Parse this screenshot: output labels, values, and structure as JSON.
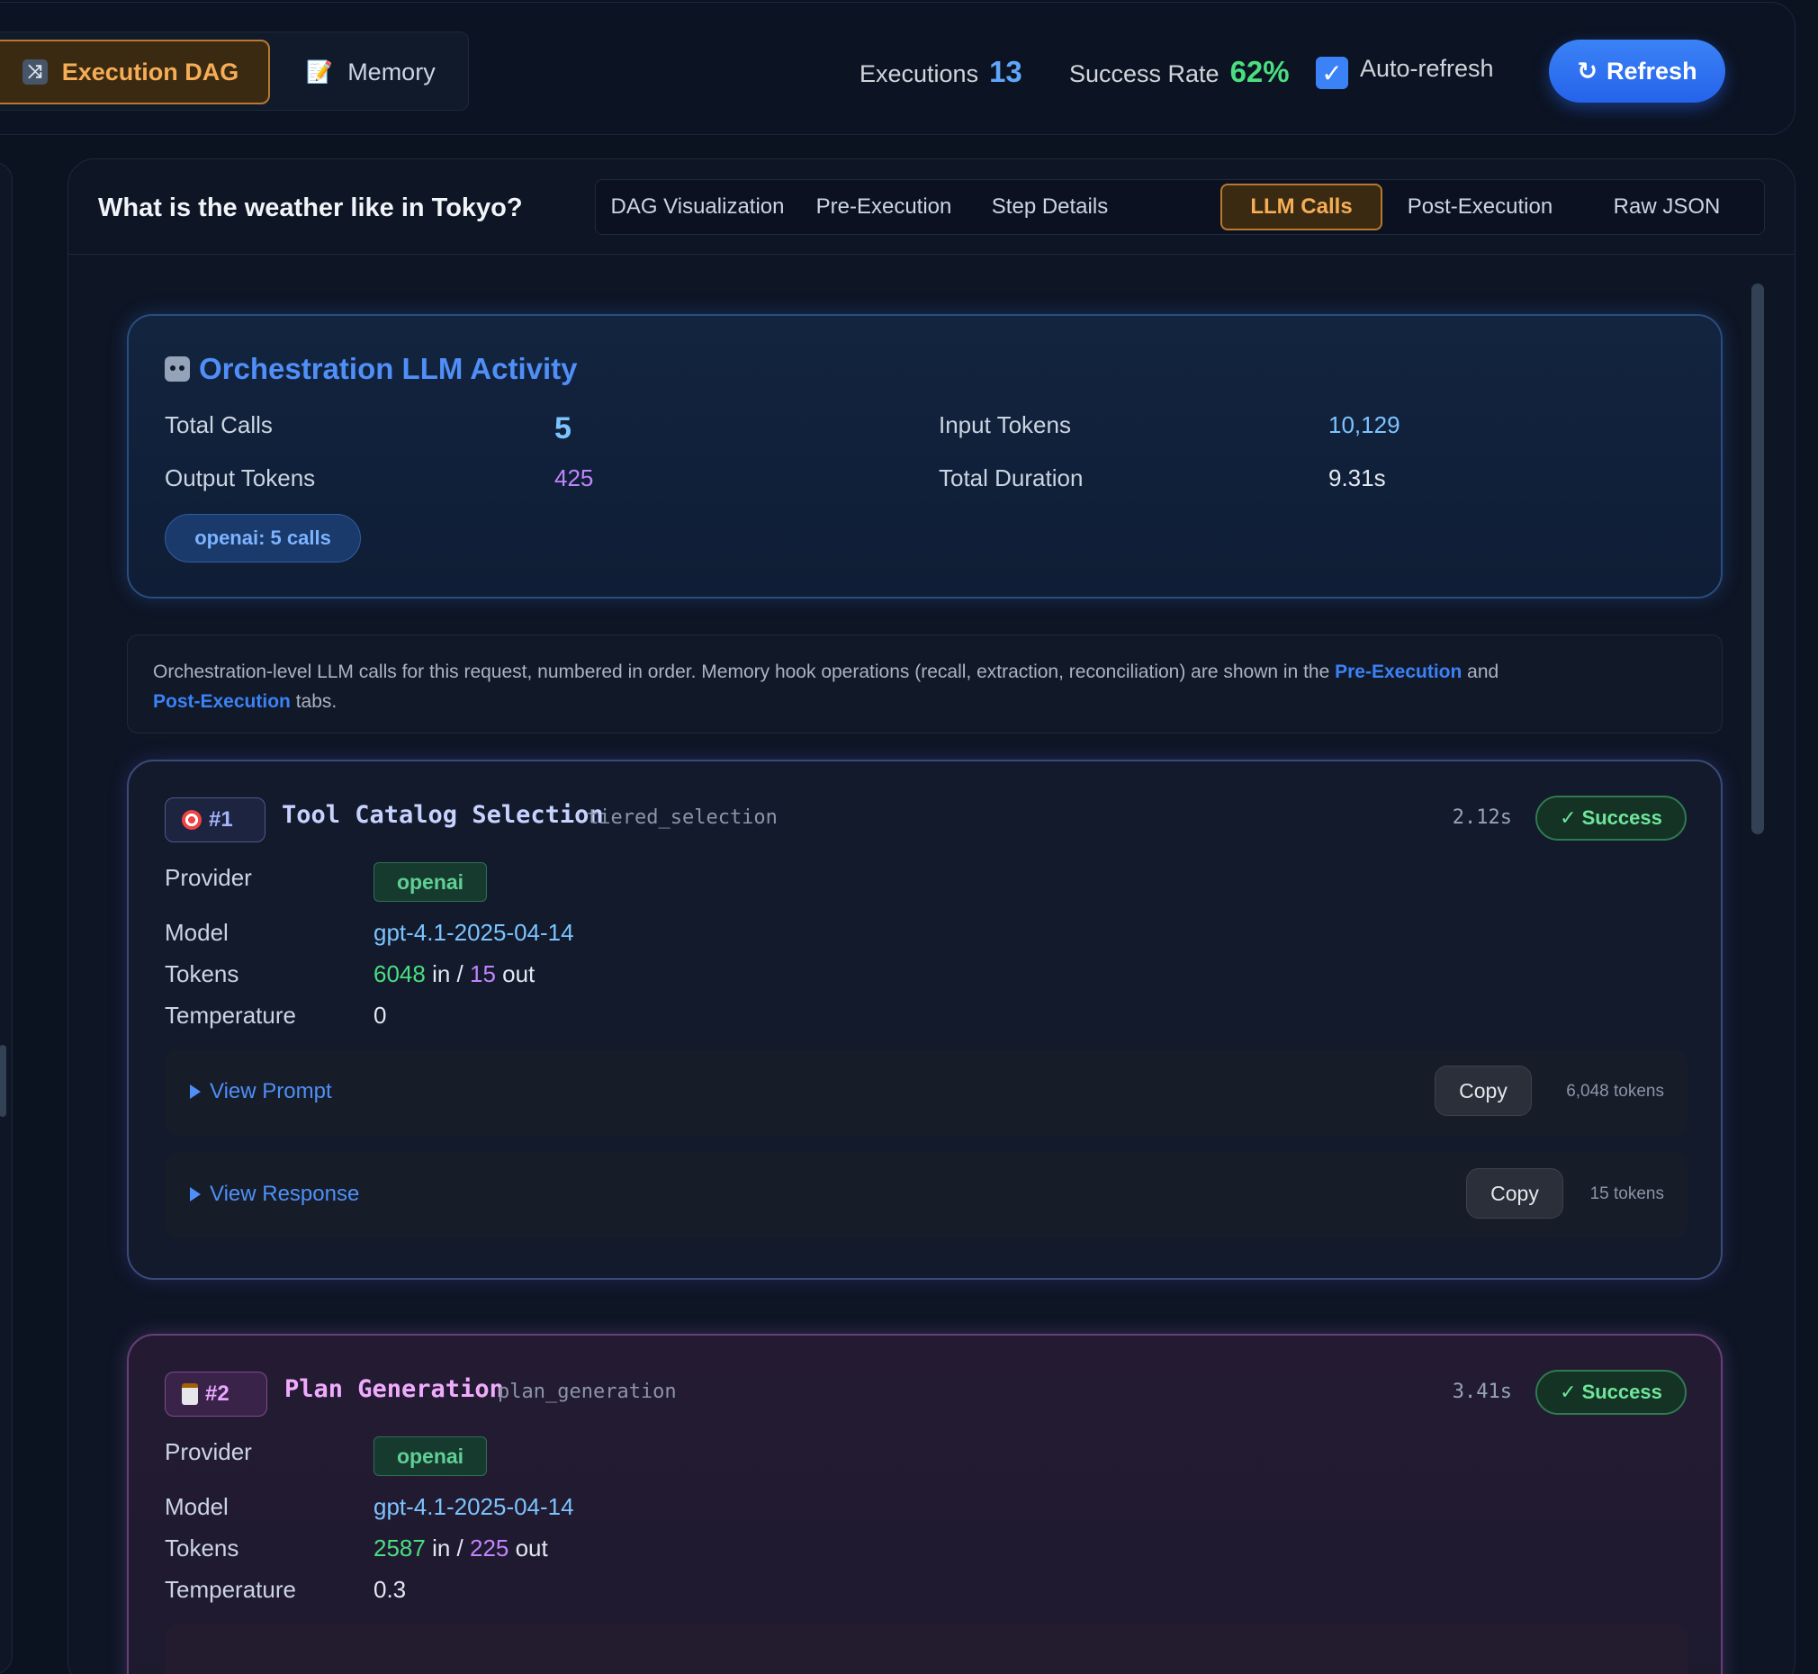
{
  "top_bar": {
    "view_tabs": [
      {
        "label": "Execution DAG",
        "icon": "shuffle-icon",
        "active": true
      },
      {
        "label": "Memory",
        "icon": "memo-icon",
        "active": false
      }
    ],
    "executions_label": "Executions",
    "executions_value": "13",
    "success_rate_label": "Success Rate",
    "success_rate_value": "62%",
    "auto_refresh_label": "Auto-refresh",
    "auto_refresh_checked": true,
    "refresh_label": "Refresh",
    "refresh_icon": "↻"
  },
  "panel": {
    "question": "What is the weather like in Tokyo?",
    "tabs": [
      {
        "label": "DAG Visualization",
        "active": false
      },
      {
        "label": "Pre-Execution",
        "active": false
      },
      {
        "label": "Step Details",
        "active": false
      },
      {
        "label": "LLM Calls",
        "active": true
      },
      {
        "label": "Post-Execution",
        "active": false
      },
      {
        "label": "Raw JSON",
        "active": false
      }
    ]
  },
  "summary": {
    "title": "Orchestration LLM Activity",
    "icon": "robot-icon",
    "total_calls_label": "Total Calls",
    "total_calls": "5",
    "input_tokens_label": "Input Tokens",
    "input_tokens": "10,129",
    "output_tokens_label": "Output Tokens",
    "output_tokens": "425",
    "total_duration_label": "Total Duration",
    "total_duration": "9.31s",
    "provider_chip": "openai: 5 calls"
  },
  "note": {
    "text_before": "Orchestration-level LLM calls for this request, numbered in order. Memory hook operations (recall, extraction, reconciliation) are shown in the ",
    "link1": "Pre-Execution",
    "text_mid": " and",
    "link2": "Post-Execution",
    "text_after": " tabs."
  },
  "labels": {
    "provider": "Provider",
    "model": "Model",
    "tokens": "Tokens",
    "temperature": "Temperature",
    "in": " in / ",
    "out": " out",
    "view_prompt": "View Prompt",
    "view_response": "View Response",
    "copy": "Copy",
    "success": "Success",
    "check": "✓"
  },
  "calls": [
    {
      "number": "#1",
      "icon": "target-icon",
      "title": "Tool Catalog Selection",
      "subtitle": "tiered_selection",
      "duration": "2.12s",
      "status": "Success",
      "provider": "openai",
      "model": "gpt-4.1-2025-04-14",
      "tokens_in": "6048",
      "tokens_out": "15",
      "temperature": "0",
      "prompt_tokens": "6,048 tokens",
      "response_tokens": "15 tokens"
    },
    {
      "number": "#2",
      "icon": "clipboard-icon",
      "title": "Plan Generation",
      "subtitle": "plan_generation",
      "duration": "3.41s",
      "status": "Success",
      "provider": "openai",
      "model": "gpt-4.1-2025-04-14",
      "tokens_in": "2587",
      "tokens_out": "225",
      "temperature": "0.3"
    }
  ],
  "colors": {
    "accent_blue": "#3b82f6",
    "active_orange": "#f6ad55",
    "green": "#6ee79a",
    "cyan": "#7cc4ff",
    "purple": "#c084fc"
  }
}
